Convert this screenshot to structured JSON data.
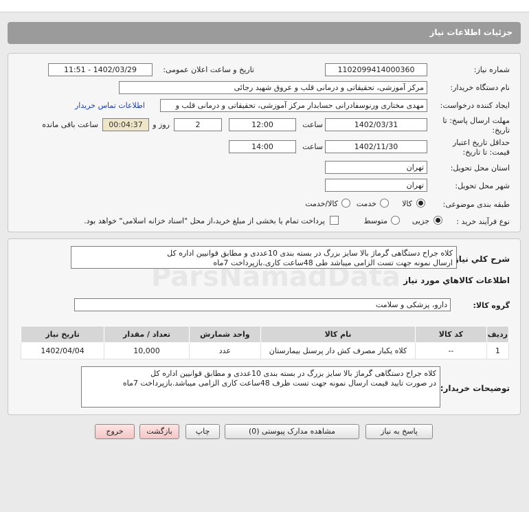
{
  "header": {
    "title": "جزئیات اطلاعات نیاز"
  },
  "details": {
    "need_number_label": "شماره نیاز:",
    "need_number": "1102099414000360",
    "announce_label": "تاریخ و ساعت اعلان عمومی:",
    "announce_value": "1402/03/29 - 11:51",
    "buyer_label": "نام دستگاه خریدار:",
    "buyer_value": "مرکز آموزشی، تحقیقاتی و درمانی قلب و عروق شهید رجائی",
    "requester_label": "ایجاد کننده درخواست:",
    "requester_value": "مهدی مختاری ورنوسفادرانی حسابدار مرکز آموزشی، تحقیقاتی و درمانی قلب و",
    "contact_link": "اطلاعات تماس خریدار",
    "reply_deadline_label_1": "مهلت ارسال پاسخ: تا",
    "reply_deadline_label_2": "تاریخ:",
    "reply_date": "1402/03/31",
    "time_label": "ساعت",
    "reply_time": "12:00",
    "days_value": "2",
    "days_label": "روز و",
    "remaining_time": "00:04:37",
    "remaining_label": "ساعت باقی مانده",
    "validity_label_1": "حداقل تاریخ اعتبار",
    "validity_label_2": "قیمت: تا تاریخ:",
    "validity_date": "1402/11/30",
    "validity_time_label": "ساعت",
    "validity_time": "14:00",
    "province_label": "استان محل تحویل:",
    "province_value": "تهران",
    "city_label": "شهر محل تحویل:",
    "city_value": "تهران",
    "category_label": "طبقه بندی موضوعی:",
    "category_options": [
      "کالا",
      "خدمت",
      "کالا/خدمت"
    ],
    "process_label": "نوع فرآیند خرید :",
    "process_options": [
      "جزیی",
      "متوسط"
    ],
    "payment_note": "پرداخت تمام یا بخشی از مبلغ خرید،از محل \"اسناد خزانه اسلامی\" خواهد بود."
  },
  "summary": {
    "label": "شرح کلي نياز:",
    "text_line_1": "کلاه جراح دستگاهی گرماژ بالا سایز بزرگ در بسته بندی 10عددی و مطابق قوانیین اداره کل",
    "text_line_2": "ارسال نمونه جهت تست الزامی میباشد طی 48ساعت کاری.بازپرداخت 7ماه"
  },
  "goods": {
    "section_title": "اطلاعات کالاهاي مورد نياز",
    "group_label": "گروه کالا:",
    "group_value": "دارو، پزشکی و سلامت",
    "columns": [
      "ردیف",
      "کد کالا",
      "نام کالا",
      "واحد شمارش",
      "تعداد / مقدار",
      "تاریخ نیاز"
    ],
    "rows": [
      [
        "1",
        "--",
        "کلاه یکبار مصرف کش دار پرسنل بیمارستان",
        "عدد",
        "10,000",
        "1402/04/04"
      ]
    ]
  },
  "buyer_notes": {
    "label": "توضیحات خریدار:",
    "text_line_1": "کلاه جراح دستگاهی گرماژ بالا سایز بزرگ در بسته بندی 10عددی و مطابق قوانیین اداره کل",
    "text_line_2": "در صورت تایید قیمت ارسال نمونه جهت تست ظرف 48ساعت کاری الزامی میباشد.بازپرداخت 7ماه"
  },
  "buttons": {
    "reply": "پاسخ به نیاز",
    "attachments": "مشاهده مدارک پیوستی (0)",
    "print": "چاپ",
    "back": "بازگشت",
    "exit": "خروج"
  },
  "watermark": "ParsNamadData"
}
